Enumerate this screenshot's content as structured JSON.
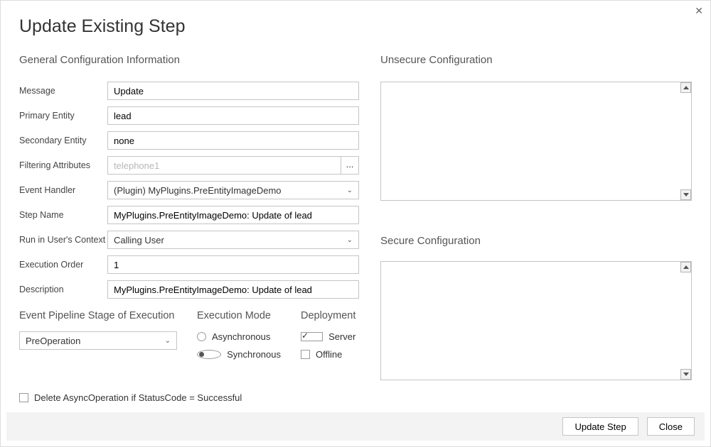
{
  "window": {
    "title": "Update Existing Step"
  },
  "general": {
    "heading": "General Configuration Information",
    "labels": {
      "message": "Message",
      "primary_entity": "Primary Entity",
      "secondary_entity": "Secondary Entity",
      "filtering_attributes": "Filtering Attributes",
      "event_handler": "Event Handler",
      "step_name": "Step Name",
      "run_context": "Run in User's Context",
      "execution_order": "Execution Order",
      "description": "Description"
    },
    "values": {
      "message": "Update",
      "primary_entity": "lead",
      "secondary_entity": "none",
      "filtering_attributes_placeholder": "telephone1",
      "event_handler": "(Plugin) MyPlugins.PreEntityImageDemo",
      "step_name": "MyPlugins.PreEntityImageDemo: Update of lead",
      "run_context": "Calling User",
      "execution_order": "1",
      "description": "MyPlugins.PreEntityImageDemo: Update of lead"
    },
    "ellipsis": "..."
  },
  "pipeline": {
    "heading": "Event Pipeline Stage of Execution",
    "value": "PreOperation"
  },
  "execution_mode": {
    "heading": "Execution Mode",
    "options": {
      "async": "Asynchronous",
      "sync": "Synchronous"
    }
  },
  "deployment": {
    "heading": "Deployment",
    "options": {
      "server": "Server",
      "offline": "Offline"
    }
  },
  "delete_async_label": "Delete AsyncOperation if StatusCode = Successful",
  "unsecure": {
    "heading": "Unsecure  Configuration",
    "value": ""
  },
  "secure": {
    "heading": "Secure  Configuration",
    "value": ""
  },
  "footer": {
    "update": "Update Step",
    "close": "Close"
  }
}
